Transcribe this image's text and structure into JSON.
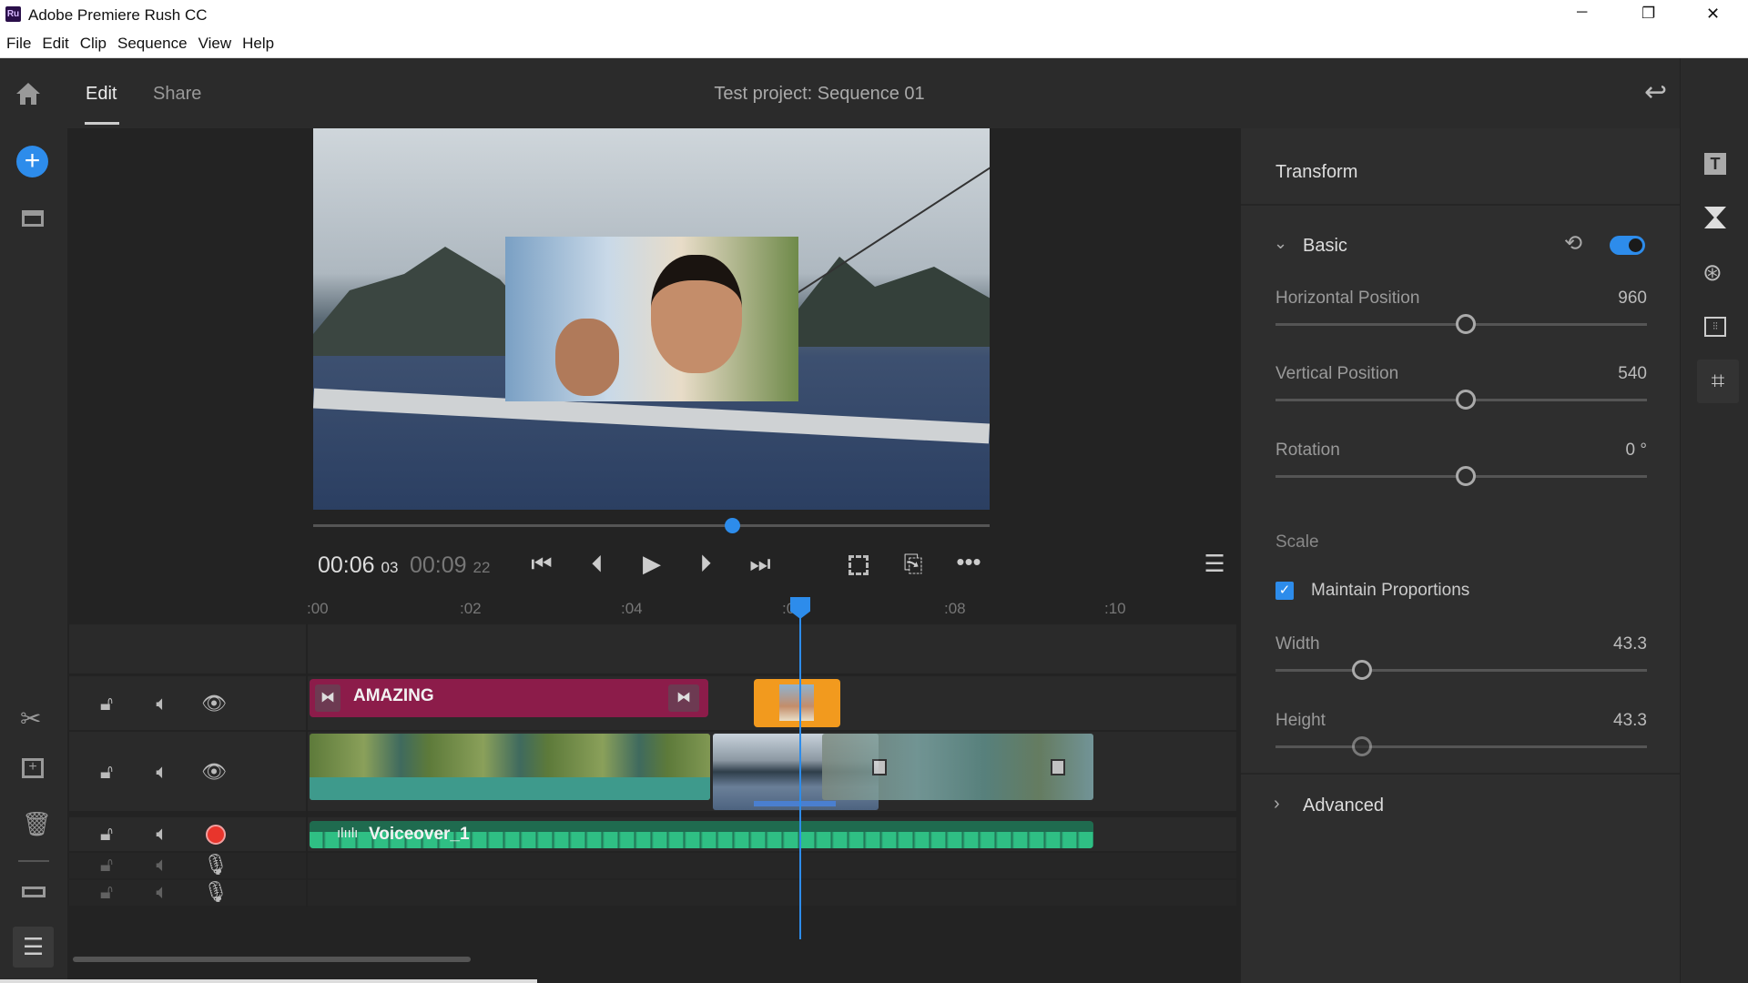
{
  "window": {
    "title": "Adobe Premiere Rush CC",
    "app_badge": "Ru",
    "minimize": "─",
    "restore": "❐",
    "close": "✕"
  },
  "menu": [
    "File",
    "Edit",
    "Clip",
    "Sequence",
    "View",
    "Help"
  ],
  "toolbar": {
    "tabs": [
      "Edit",
      "Share"
    ],
    "active_tab": "Edit",
    "project_title": "Test project: Sequence 01"
  },
  "player": {
    "current_time": "00:06",
    "current_frames": "03",
    "duration": "00:09",
    "duration_frames": "22",
    "progress": 0.62
  },
  "ruler": {
    "labels": [
      ":00",
      ":02",
      ":04",
      ":06",
      ":08",
      ":10"
    ]
  },
  "timeline": {
    "title_clip": "AMAZING",
    "audio_clip": "Voiceover_1",
    "playhead_seconds": 6.1
  },
  "transform": {
    "title": "Transform",
    "basic": "Basic",
    "basic_enabled": true,
    "fields": [
      {
        "label": "Horizontal Position",
        "value": "960",
        "fraction": 0.51
      },
      {
        "label": "Vertical Position",
        "value": "540",
        "fraction": 0.51
      },
      {
        "label": "Rotation",
        "value": "0 °",
        "fraction": 0.51
      }
    ],
    "scale_label": "Scale",
    "maintain_proportions": "Maintain Proportions",
    "maintain_checked": true,
    "scale_fields": [
      {
        "label": "Width",
        "value": "43.3",
        "fraction": 0.24
      },
      {
        "label": "Height",
        "value": "43.3",
        "fraction": 0.24
      }
    ],
    "advanced": "Advanced"
  },
  "colors": {
    "accent": "#2d8ceb",
    "title_clip": "#8c1c4a",
    "overlay_clip": "#f29a1e",
    "audio": "#2fbf84",
    "record": "#e8352c"
  }
}
